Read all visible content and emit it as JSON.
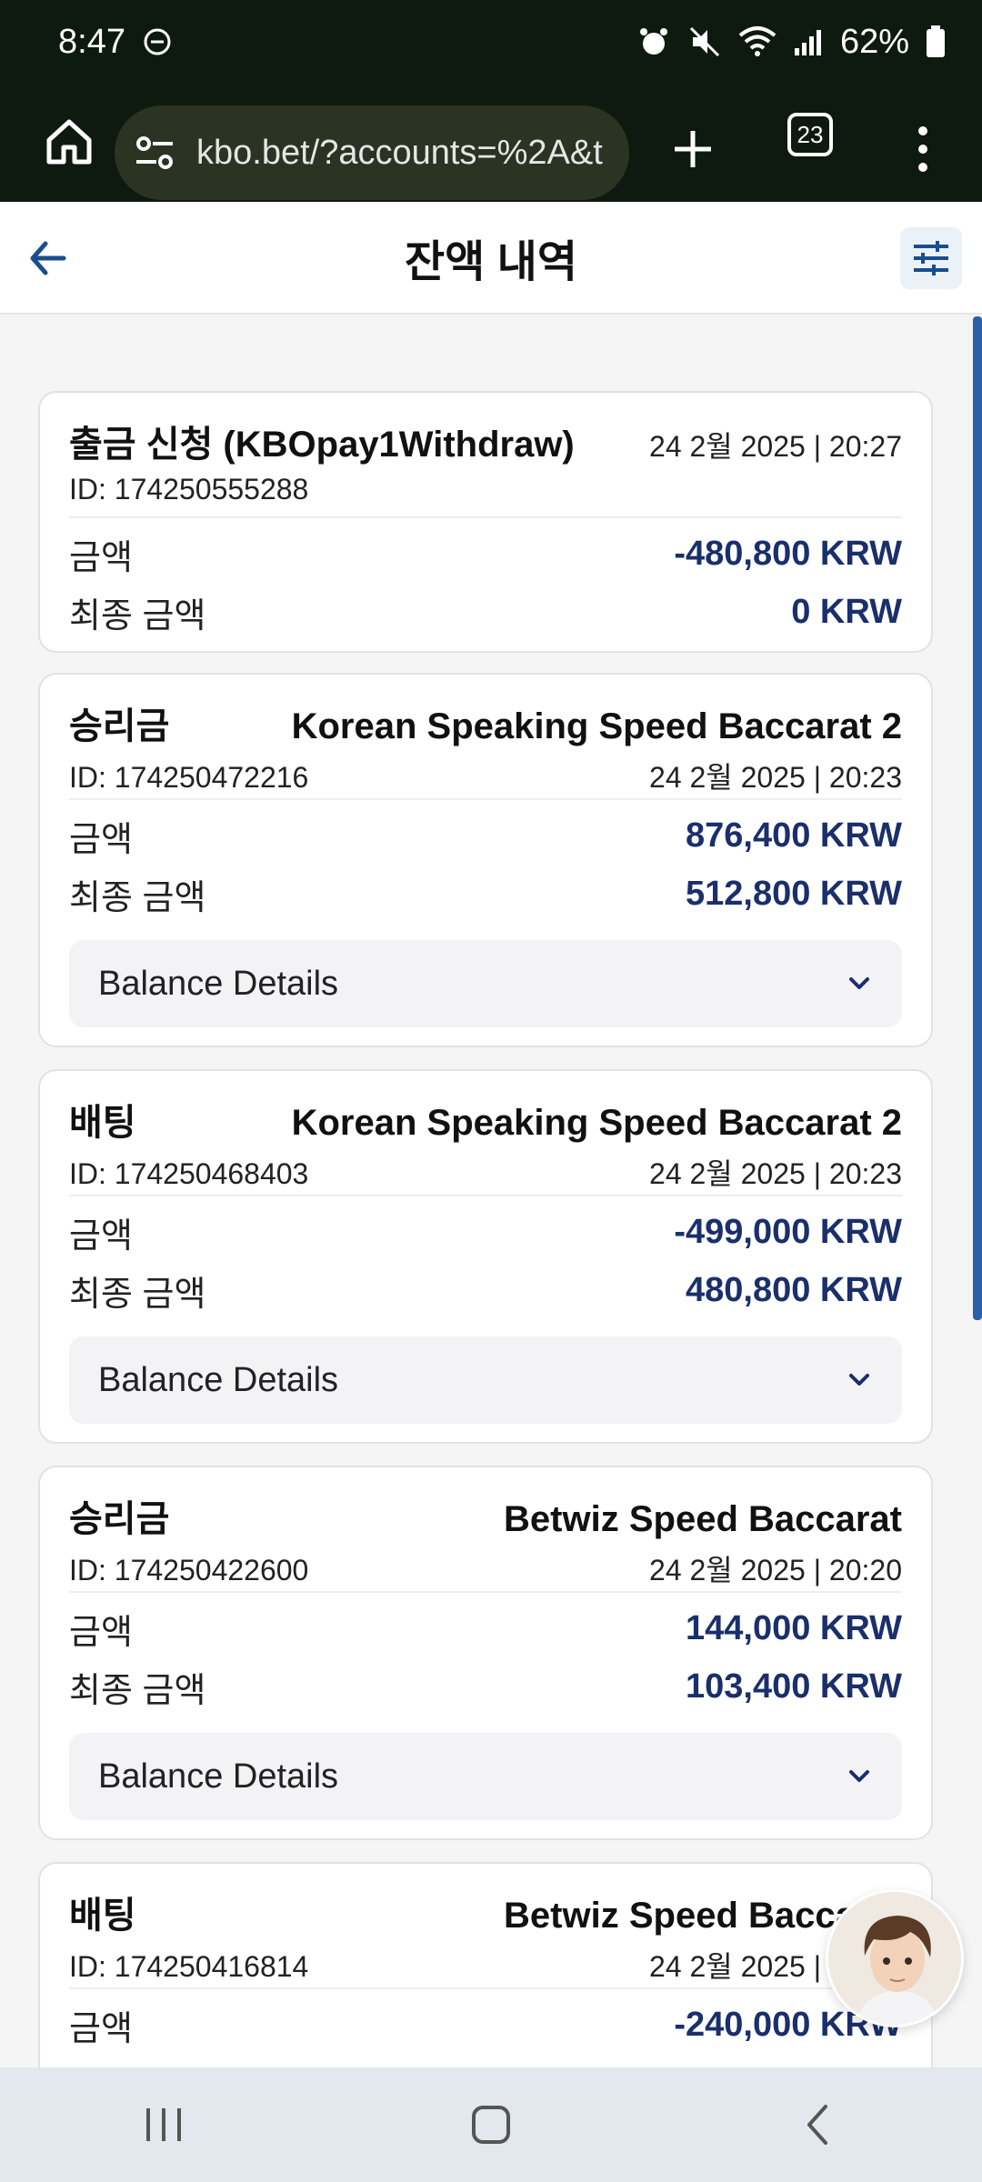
{
  "status": {
    "time": "8:47",
    "battery": "62%"
  },
  "browser": {
    "url": "kbo.bet/?accounts=%2A&t",
    "tab_count": "23"
  },
  "header": {
    "title": "잔액 내역"
  },
  "colors": {
    "amount_color": "#1a2f6b",
    "accent": "#2b5fa8"
  },
  "transactions": [
    {
      "type": "출금 신청 (KBOpay1Withdraw)",
      "game": "",
      "id": "ID: 174250555288",
      "date": "24 2월 2025 | 20:27",
      "amount_label": "금액",
      "amount": "-480,800 KRW",
      "final_label": "최종 금액",
      "final": "0 KRW",
      "details_label": ""
    },
    {
      "type": "승리금",
      "game": "Korean Speaking Speed Baccarat 2",
      "id": "ID: 174250472216",
      "date": "24 2월 2025 | 20:23",
      "amount_label": "금액",
      "amount": "876,400 KRW",
      "final_label": "최종 금액",
      "final": "512,800 KRW",
      "details_label": "Balance Details"
    },
    {
      "type": "배팅",
      "game": "Korean Speaking Speed Baccarat 2",
      "id": "ID: 174250468403",
      "date": "24 2월 2025 | 20:23",
      "amount_label": "금액",
      "amount": "-499,000 KRW",
      "final_label": "최종 금액",
      "final": "480,800 KRW",
      "details_label": "Balance Details"
    },
    {
      "type": "승리금",
      "game": "Betwiz Speed Baccarat",
      "id": "ID: 174250422600",
      "date": "24 2월 2025 | 20:20",
      "amount_label": "금액",
      "amount": "144,000 KRW",
      "final_label": "최종 금액",
      "final": "103,400 KRW",
      "details_label": "Balance Details"
    },
    {
      "type": "배팅",
      "game": "Betwiz Speed Baccarat",
      "id": "ID: 174250416814",
      "date": "24 2월 2025 | 20:17",
      "amount_label": "금액",
      "amount": "-240,000 KRW",
      "final_label": "",
      "final": "",
      "details_label": ""
    }
  ]
}
